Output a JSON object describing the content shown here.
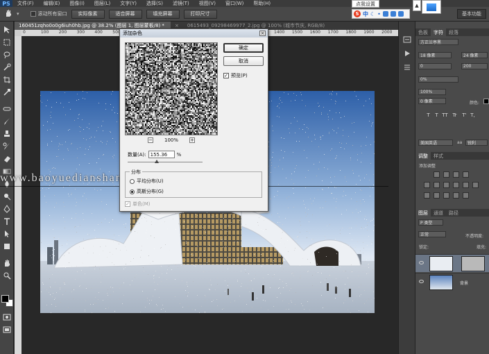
{
  "menubar": {
    "logo": "PS",
    "items": [
      "文件(F)",
      "编辑(E)",
      "图像(I)",
      "图层(L)",
      "文字(Y)",
      "选择(S)",
      "滤镜(T)",
      "视图(V)",
      "窗口(W)",
      "帮助(H)"
    ]
  },
  "options": {
    "scroll_all_label": "滚动所有窗口",
    "buttons": [
      "实际像素",
      "适合屏幕",
      "填充屏幕",
      "打印尺寸"
    ],
    "workspace_label": "基本功能"
  },
  "ime": {
    "tooltip": "点我设置",
    "logo": "S",
    "mode": "中",
    "tray_arrow": "▲"
  },
  "document": {
    "tabs": [
      {
        "label": "160451zqho0o0g6iuh0hb.jpg @ 38.2% (图层 1, 图层蒙板/8) *",
        "active": true
      },
      {
        "label": "×",
        "active": false
      },
      {
        "label": "0615493_09298469977_2.jpg @ 100% (城市节庆, RGB/8)",
        "active": false
      }
    ],
    "ruler_ticks": [
      "0",
      "100",
      "200",
      "300",
      "400",
      "500",
      "600",
      "700",
      "800",
      "900",
      "1000",
      "1100",
      "1200",
      "1300",
      "1400",
      "1500",
      "1600",
      "1700",
      "1800",
      "1900",
      "2000"
    ],
    "watermark": "www.baoyuedianshang.com"
  },
  "dialog": {
    "title": "添加杂色",
    "close": "×",
    "ok_label": "确定",
    "cancel_label": "取消",
    "preview_label": "预览(P)",
    "zoom_minus": "−",
    "zoom_plus": "+",
    "zoom_level": "100%",
    "amount_label": "数量(A):",
    "amount_value": "155.36",
    "amount_unit": "%",
    "amount_fraction": 0.39,
    "distribution_label": "分布",
    "uniform_label": "平均分布(U)",
    "gaussian_label": "高斯分布(G)",
    "selected_distribution": "gaussian",
    "monochrome_label": "单色(M)",
    "monochrome_checked": true
  },
  "panels": {
    "char_tabs": [
      "色板",
      "字符",
      "段落"
    ],
    "font_family": "方正兰亭黑",
    "font_size": "18 像素",
    "leading": "24 像素",
    "kerning": "0",
    "tracking": "200",
    "scale_v": "100%",
    "scale_h": "100%",
    "baseline": "0 像素",
    "color_label": "颜色:",
    "tracking_pct": "0%",
    "text_styles": [
      "T",
      "T",
      "TT",
      "Tr",
      "T'",
      "T,",
      "T",
      "F"
    ],
    "lang": "美国英语",
    "aa": "aa",
    "aa_mode": "锐利",
    "adj_tabs": [
      "调整",
      "样式"
    ],
    "adj_title": "添加调整",
    "layer_tabs": [
      "图层",
      "通道",
      "路径"
    ],
    "layer_filter": "P 类型",
    "blend_mode": "正常",
    "opacity_label": "不透明度:",
    "opacity_value": "100%",
    "lock_label": "锁定:",
    "fill_label": "填充:",
    "layers": [
      {
        "name": "",
        "has_mask": true
      },
      {
        "name": "背景",
        "has_mask": false
      }
    ]
  }
}
